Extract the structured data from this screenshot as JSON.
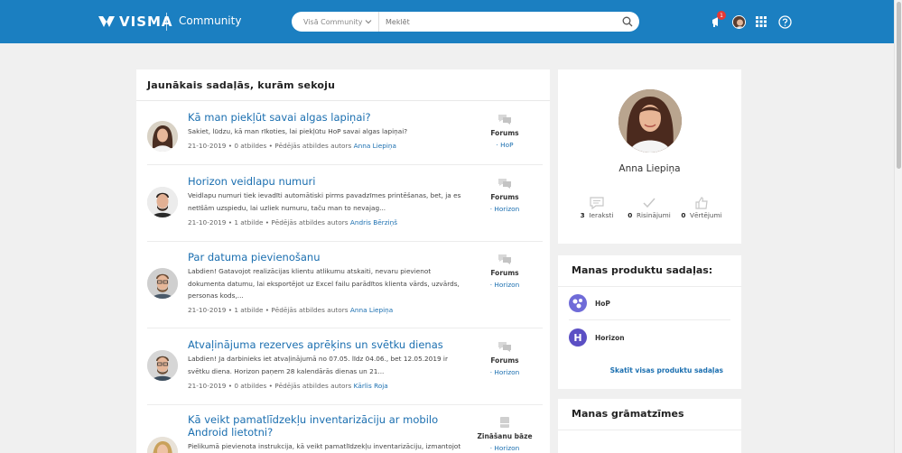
{
  "header": {
    "brand": "VISMA",
    "section": "Community",
    "search_scope": "Visā Community",
    "search_placeholder": "Meklēt",
    "notification_count": "1",
    "colors": {
      "bar": "#1b7fc1",
      "link": "#1b6fb0",
      "badge": "#e53935"
    }
  },
  "feed": {
    "title": "Jaunākais sadaļās, kurām sekoju",
    "posts": [
      {
        "title": "Kā man piekļūt savai algas lapiņai?",
        "excerpt": "Sakiet, lūdzu, kā man rīkoties, lai piekļūtu HoP savai algas lapiņai?",
        "meta": "21-10-2019 • 0 atbildes • Pēdējās atbildes autors ",
        "author": "Anna Liepiņa",
        "category": "Forums",
        "sub": "· HoP",
        "cat_icon": "forum-icon"
      },
      {
        "title": "Horizon veidlapu numuri",
        "excerpt": "Veidlapu numuri tiek ievadīti automātiski pirms pavadzīmes printēšanas, bet, ja es netīšām uzspiedu, lai uzliek numuru, taču man to nevajag...",
        "meta": "21-10-2019 • 1 atbilde • Pēdējās atbildes autors ",
        "author": "Andris Bērziņš",
        "category": "Forums",
        "sub": "· Horizon",
        "cat_icon": "forum-icon"
      },
      {
        "title": "Par datuma pievienošanu",
        "excerpt": "Labdien! Gatavojot realizācijas klientu atlikumu atskaiti, nevaru pievienot dokumenta datumu, lai eksportējot uz Excel failu parādītos klienta vārds, uzvārds, personas kods,...",
        "meta": "21-10-2019 • 1 atbilde • Pēdējās atbildes autors ",
        "author": "Anna Liepiņa",
        "category": "Forums",
        "sub": "· Horizon",
        "cat_icon": "forum-icon"
      },
      {
        "title": "Atvaļinājuma rezerves aprēķins un svētku dienas",
        "excerpt": "Labdien! Ja darbinieks iet atvaļinājumā no 07.05. līdz 04.06., bet 12.05.2019 ir svētku diena. Horizon paņem 28 kalendārās dienas un 21...",
        "meta": "21-10-2019 • 0 atbildes • Pēdējās atbildes autors ",
        "author": "Kārlis Roja",
        "category": "Forums",
        "sub": "· Horizon",
        "cat_icon": "forum-icon"
      },
      {
        "title": "Kā veikt pamatlīdzekļu inventarizāciju ar mobilo Android lietotni?",
        "excerpt": "Pielikumā pievienota instrukcija, kā veikt pamatlīdzekļu inventarizāciju, izmantojot",
        "meta": "",
        "author": "",
        "category": "Zināšanu bāze",
        "sub": "· Horizon",
        "cat_icon": "knowledge-base-icon"
      }
    ]
  },
  "profile": {
    "name": "Anna Liepiņa",
    "stats": [
      {
        "count": "3",
        "label": "Ieraksti",
        "icon": "posts-icon"
      },
      {
        "count": "0",
        "label": "Risinājumi",
        "icon": "solutions-icon"
      },
      {
        "count": "0",
        "label": "Vērtējumi",
        "icon": "kudos-icon"
      }
    ]
  },
  "products": {
    "heading": "Manas produktu sadaļas:",
    "items": [
      {
        "label": "HoP",
        "color": "#6f6bd8"
      },
      {
        "label": "Horizon",
        "color": "#5b4fc4",
        "letter": "H"
      }
    ],
    "see_all": "Skatīt visas produktu sadaļas"
  },
  "bookmarks": {
    "heading": "Manas grāmatzīmes"
  }
}
